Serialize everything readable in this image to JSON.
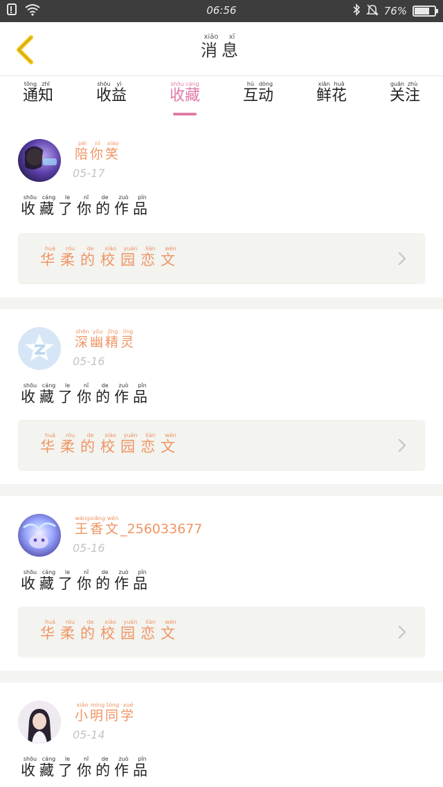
{
  "status_bar": {
    "time": "06:56",
    "battery": "76%",
    "battery_level": 0.76
  },
  "header": {
    "title_chars": [
      {
        "c": "消",
        "p": "xiāo"
      },
      {
        "c": "息",
        "p": "xī"
      }
    ]
  },
  "tabs": [
    {
      "chars": [
        {
          "c": "通",
          "p": "tōng"
        },
        {
          "c": "知",
          "p": "zhī"
        }
      ]
    },
    {
      "chars": [
        {
          "c": "收",
          "p": "shōu"
        },
        {
          "c": "益",
          "p": "yì"
        }
      ]
    },
    {
      "chars": [
        {
          "c": "收",
          "p": "shōu"
        },
        {
          "c": "藏",
          "p": "cáng"
        }
      ],
      "active": true
    },
    {
      "chars": [
        {
          "c": "互",
          "p": "hù"
        },
        {
          "c": "动",
          "p": "dòng"
        }
      ]
    },
    {
      "chars": [
        {
          "c": "鲜",
          "p": "xiān"
        },
        {
          "c": "花",
          "p": "huā"
        }
      ]
    },
    {
      "chars": [
        {
          "c": "关",
          "p": "guān"
        },
        {
          "c": "注",
          "p": "zhù"
        }
      ]
    }
  ],
  "messages": [
    {
      "user_chars": [
        {
          "c": "陪",
          "p": "péi"
        },
        {
          "c": "你",
          "p": "nǐ"
        },
        {
          "c": "笑",
          "p": "xiào"
        }
      ],
      "user_suffix": "",
      "date": "05-17",
      "avatar": "photo-avatar",
      "action_chars": [
        {
          "c": "收",
          "p": "shōu"
        },
        {
          "c": "藏",
          "p": "cáng"
        },
        {
          "c": "了",
          "p": "le"
        },
        {
          "c": "你",
          "p": "nǐ"
        },
        {
          "c": "的",
          "p": "de"
        },
        {
          "c": "作",
          "p": "zuò"
        },
        {
          "c": "品",
          "p": "pǐn"
        }
      ],
      "work_chars": [
        {
          "c": "华",
          "p": "huá"
        },
        {
          "c": "柔",
          "p": "róu"
        },
        {
          "c": "的",
          "p": "de"
        },
        {
          "c": "校",
          "p": "xiào"
        },
        {
          "c": "园",
          "p": "yuán"
        },
        {
          "c": "恋",
          "p": "liàn"
        },
        {
          "c": "文",
          "p": "wén"
        }
      ]
    },
    {
      "user_chars": [
        {
          "c": "深",
          "p": "shēn"
        },
        {
          "c": "幽",
          "p": "yōu"
        },
        {
          "c": "精",
          "p": "jīng"
        },
        {
          "c": "灵",
          "p": "líng"
        }
      ],
      "user_suffix": "",
      "date": "05-16",
      "avatar": "default-avatar",
      "action_chars": [
        {
          "c": "收",
          "p": "shōu"
        },
        {
          "c": "藏",
          "p": "cáng"
        },
        {
          "c": "了",
          "p": "le"
        },
        {
          "c": "你",
          "p": "nǐ"
        },
        {
          "c": "的",
          "p": "de"
        },
        {
          "c": "作",
          "p": "zuò"
        },
        {
          "c": "品",
          "p": "pǐn"
        }
      ],
      "work_chars": [
        {
          "c": "华",
          "p": "huá"
        },
        {
          "c": "柔",
          "p": "róu"
        },
        {
          "c": "的",
          "p": "de"
        },
        {
          "c": "校",
          "p": "xiào"
        },
        {
          "c": "园",
          "p": "yuán"
        },
        {
          "c": "恋",
          "p": "liàn"
        },
        {
          "c": "文",
          "p": "wén"
        }
      ]
    },
    {
      "user_chars": [
        {
          "c": "王",
          "p": "wáng"
        },
        {
          "c": "香",
          "p": "xiāng"
        },
        {
          "c": "文",
          "p": "wén"
        }
      ],
      "user_suffix": "_256033677",
      "date": "05-16",
      "avatar": "anime-avatar",
      "action_chars": [
        {
          "c": "收",
          "p": "shōu"
        },
        {
          "c": "藏",
          "p": "cáng"
        },
        {
          "c": "了",
          "p": "le"
        },
        {
          "c": "你",
          "p": "nǐ"
        },
        {
          "c": "的",
          "p": "de"
        },
        {
          "c": "作",
          "p": "zuò"
        },
        {
          "c": "品",
          "p": "pǐn"
        }
      ],
      "work_chars": [
        {
          "c": "华",
          "p": "huá"
        },
        {
          "c": "柔",
          "p": "róu"
        },
        {
          "c": "的",
          "p": "de"
        },
        {
          "c": "校",
          "p": "xiào"
        },
        {
          "c": "园",
          "p": "yuán"
        },
        {
          "c": "恋",
          "p": "liàn"
        },
        {
          "c": "文",
          "p": "wén"
        }
      ]
    },
    {
      "user_chars": [
        {
          "c": "小",
          "p": "xiǎo"
        },
        {
          "c": "明",
          "p": "míng"
        },
        {
          "c": "同",
          "p": "tóng"
        },
        {
          "c": "学",
          "p": "xué"
        }
      ],
      "user_suffix": "",
      "date": "05-14",
      "avatar": "girl-avatar",
      "action_chars": [
        {
          "c": "收",
          "p": "shōu"
        },
        {
          "c": "藏",
          "p": "cáng"
        },
        {
          "c": "了",
          "p": "le"
        },
        {
          "c": "你",
          "p": "nǐ"
        },
        {
          "c": "的",
          "p": "de"
        },
        {
          "c": "作",
          "p": "zuò"
        },
        {
          "c": "品",
          "p": "pǐn"
        }
      ]
    }
  ],
  "colors": {
    "accent_pink": "#e07aa8",
    "accent_orange": "#ef9463",
    "separator": "#f4f4f2",
    "work_box": "#f3f3ef"
  }
}
